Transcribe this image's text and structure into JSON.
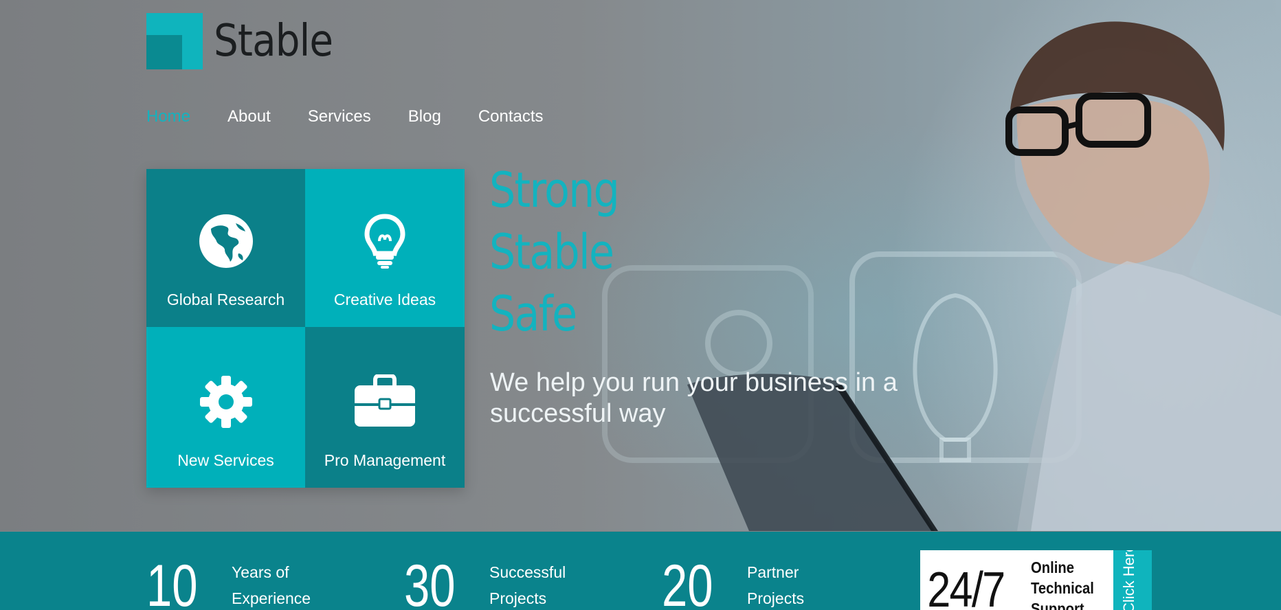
{
  "logo": {
    "text": "Stable"
  },
  "nav": {
    "items": [
      {
        "label": "Home",
        "active": true
      },
      {
        "label": "About",
        "active": false
      },
      {
        "label": "Services",
        "active": false
      },
      {
        "label": "Blog",
        "active": false
      },
      {
        "label": "Contacts",
        "active": false
      }
    ]
  },
  "tiles": [
    {
      "label": "Global Research",
      "icon": "globe-icon"
    },
    {
      "label": "Creative Ideas",
      "icon": "lightbulb-icon"
    },
    {
      "label": "New Services",
      "icon": "gear-icon"
    },
    {
      "label": "Pro Management",
      "icon": "briefcase-icon"
    }
  ],
  "hero": {
    "headline": [
      "Strong",
      "Stable",
      "Safe"
    ],
    "tagline": "We help you run your business in a successful way"
  },
  "stats": [
    {
      "number": "10",
      "label": "Years of Experience"
    },
    {
      "number": "30",
      "label": "Successful Projects"
    },
    {
      "number": "20",
      "label": "Partner Projects"
    }
  ],
  "support": {
    "big": "24/7",
    "text": "Online Technical Support",
    "cta": "Click Here"
  },
  "colors": {
    "accent": "#13b3bf",
    "tile_dark": "#0b8089",
    "tile_light": "#00b0ba",
    "stats_bg": "#0a838c"
  }
}
